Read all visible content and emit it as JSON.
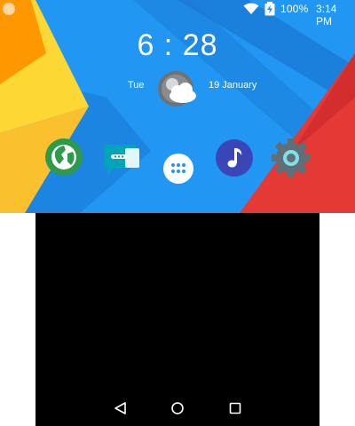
{
  "status_bar": {
    "battery_percent": "100%",
    "time": "3:14 PM",
    "icons": [
      "notification-dot",
      "wifi-icon",
      "battery-charging-icon"
    ]
  },
  "lock": {
    "clock": "6 : 28",
    "day": "Tue",
    "date": "19 January",
    "weather_icon": "partly-cloudy-icon"
  },
  "dock": {
    "apps": [
      {
        "name": "browser",
        "icon": "globe-icon",
        "color": "#2e9b4a"
      },
      {
        "name": "messages",
        "icon": "chat-icon",
        "color": "#00a5b8"
      },
      {
        "name": "app-drawer",
        "icon": "grid-dots-icon",
        "color": "#ffffff"
      },
      {
        "name": "music",
        "icon": "music-note-icon",
        "color": "#3a46b8"
      },
      {
        "name": "settings",
        "icon": "gear-icon",
        "color": "#5f6f78"
      }
    ]
  },
  "nav_bar": {
    "buttons": [
      "back-icon",
      "home-icon",
      "recents-icon"
    ]
  },
  "colors": {
    "wallpaper_blue": "#2196f3",
    "wallpaper_yellow": "#fdd835",
    "wallpaper_orange": "#ff9800",
    "wallpaper_red": "#e53935",
    "bottom_screen": "#000000"
  }
}
